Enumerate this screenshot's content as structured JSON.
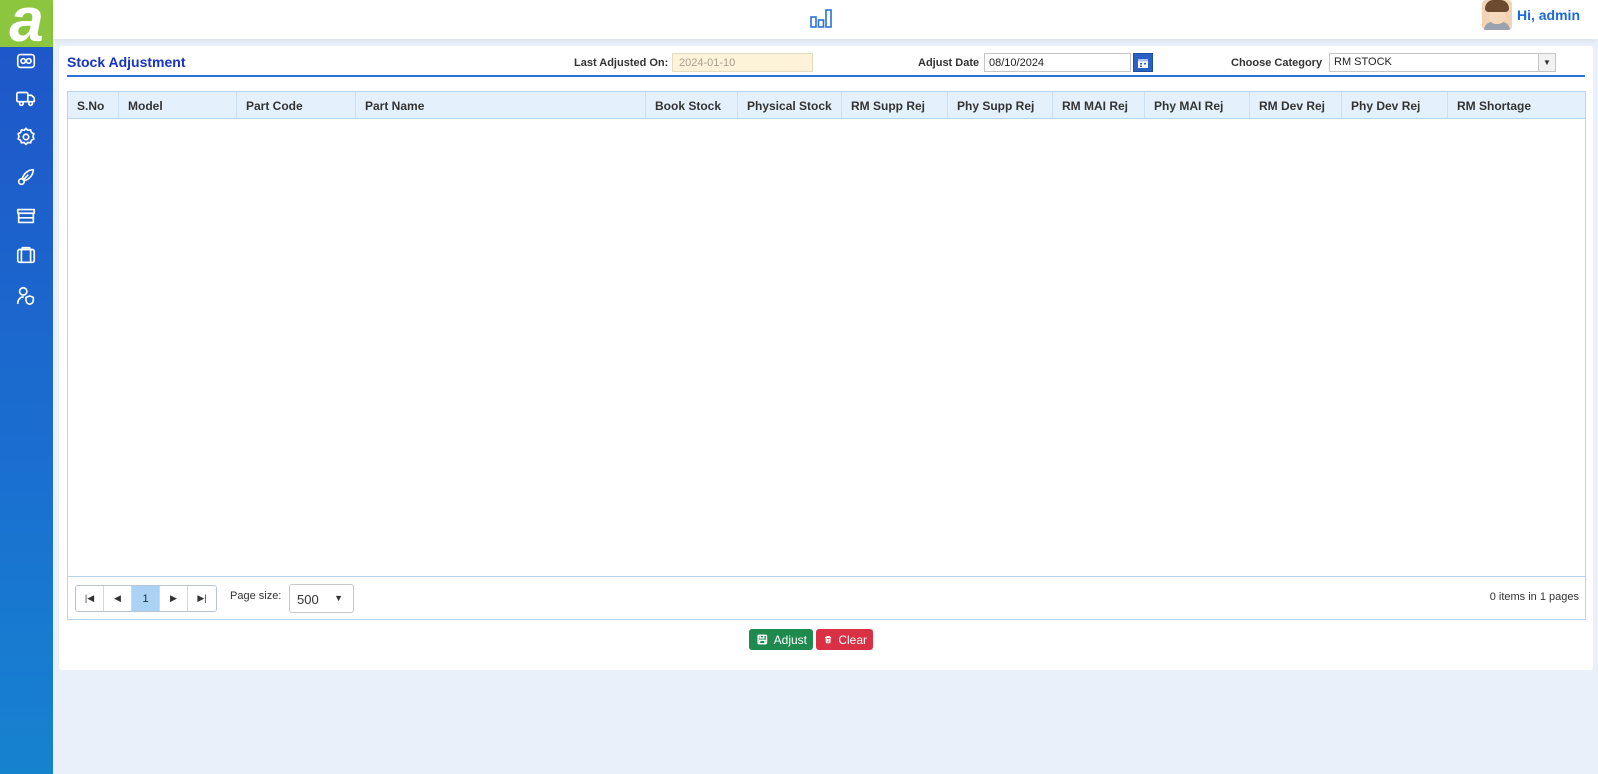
{
  "brand": {
    "logo_letter": "a",
    "color": "#8cc63f"
  },
  "sidebar": {
    "items": [
      {
        "icon": "camera-icon"
      },
      {
        "icon": "truck-icon"
      },
      {
        "icon": "gear-icon"
      },
      {
        "icon": "rocket-icon"
      },
      {
        "icon": "store-icon"
      },
      {
        "icon": "briefcase-icon"
      },
      {
        "icon": "user-shield-icon"
      }
    ]
  },
  "topbar": {
    "center_icon": "bar-chart-icon",
    "user_greeting": "Hi, admin"
  },
  "page": {
    "title": "Stock Adjustment",
    "last_adjusted_label": "Last Adjusted On:",
    "last_adjusted_value": "2024-01-10",
    "adjust_date_label": "Adjust Date",
    "adjust_date_value": "08/10/2024",
    "category_label": "Choose Category",
    "category_value": "RM STOCK"
  },
  "grid": {
    "columns": [
      "S.No",
      "Model",
      "Part Code",
      "Part Name",
      "Book Stock",
      "Physical Stock",
      "RM Supp Rej",
      "Phy Supp Rej",
      "RM MAI Rej",
      "Phy MAI Rej",
      "RM Dev Rej",
      "Phy Dev Rej",
      "RM Shortage"
    ],
    "rows": []
  },
  "pager": {
    "current_page": "1",
    "page_size_label": "Page size:",
    "page_size": "500",
    "info": "0 items in 1 pages"
  },
  "actions": {
    "adjust_label": "Adjust",
    "clear_label": "Clear"
  },
  "colors": {
    "accent": "#2a72d8",
    "title": "#1733c4",
    "adjust_button": "#1e8a4d",
    "clear_button": "#d93143"
  }
}
